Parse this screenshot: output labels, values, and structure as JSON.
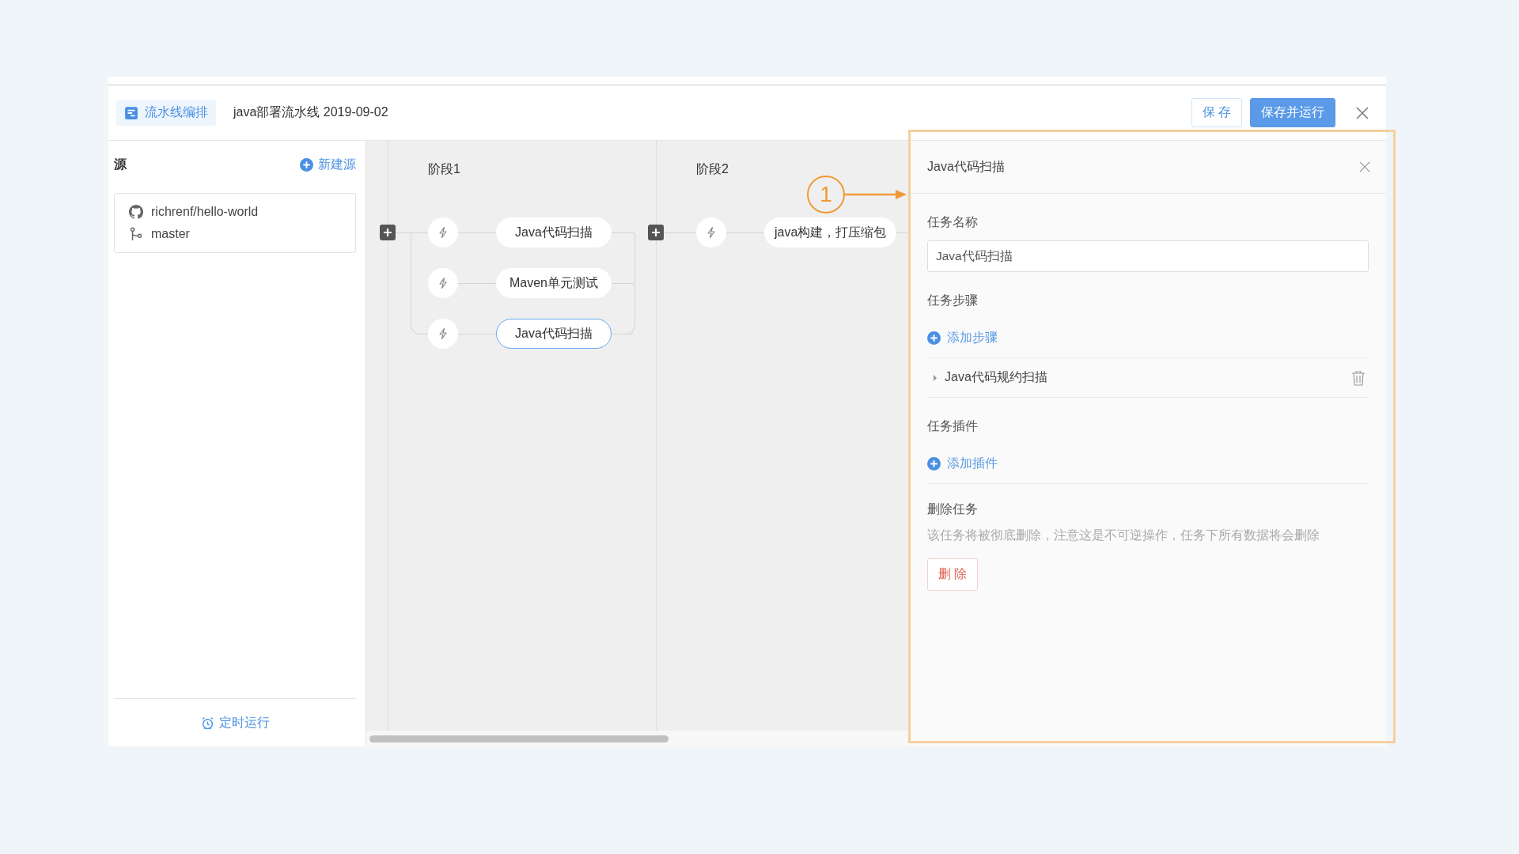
{
  "header": {
    "title_tab": "流水线编排",
    "pipeline_name": "java部署流水线 2019-09-02",
    "buttons": [
      {
        "label": "保 存",
        "kind": "default"
      },
      {
        "label": "保存并运行",
        "kind": "primary"
      }
    ]
  },
  "source_panel": {
    "title": "源",
    "new_button": "新建源",
    "repo": "richrenf/hello-world",
    "branch": "master",
    "schedule_button": "定时运行"
  },
  "stages": [
    {
      "title": "阶段1",
      "jobs": [
        {
          "name": "Java代码扫描",
          "selected": false
        },
        {
          "name": "Maven单元测试",
          "selected": false
        },
        {
          "name": "Java代码扫描",
          "selected": true
        }
      ]
    },
    {
      "title": "阶段2",
      "jobs": [
        {
          "name": "java构建，打压缩包",
          "selected": false
        }
      ]
    }
  ],
  "annotation": {
    "label": "1"
  },
  "task_panel": {
    "title": "Java代码扫描",
    "name_label": "任务名称",
    "name_value": "Java代码扫描",
    "steps_label": "任务步骤",
    "add_step": "添加步骤",
    "steps": [
      {
        "name": "Java代码规约扫描",
        "expanded": false
      }
    ],
    "plugins_label": "任务插件",
    "add_plugin": "添加插件",
    "delete_label": "删除任务",
    "delete_hint": "该任务将被彻底删除，注意这是不可逆操作，任务下所有数据将会删除",
    "delete_button": "删 除"
  }
}
